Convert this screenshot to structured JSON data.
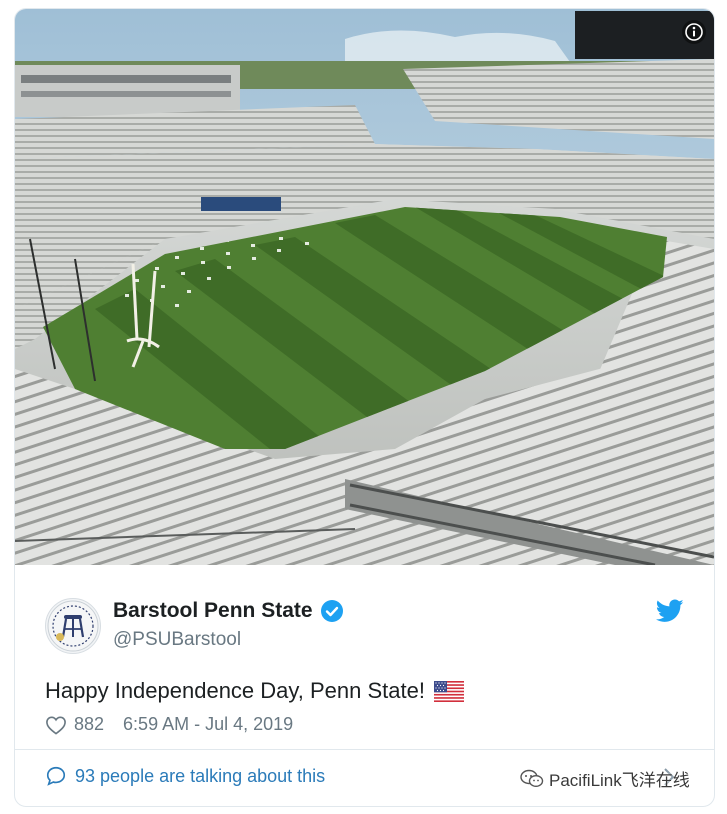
{
  "tweet": {
    "display_name": "Barstool Penn State",
    "handle": "@PSUBarstool",
    "text": "Happy Independence Day, Penn State!",
    "likes": "882",
    "timestamp": "6:59 AM - Jul 4, 2019",
    "conversation": "93 people are talking about this"
  },
  "icons": {
    "info": "info-icon",
    "verified": "verified-badge-icon",
    "twitter": "twitter-bird-icon",
    "flag": "us-flag-emoji",
    "like": "heart-outline-icon",
    "reply": "speech-bubble-icon",
    "wechat": "wechat-icon"
  },
  "colors": {
    "twitter_blue": "#1da1f2",
    "link_blue": "#2b7bb9",
    "muted": "#697882",
    "text": "#1c2022",
    "border": "#e1e8ed"
  },
  "watermark": {
    "text": "PacifiLink飞洋在线"
  }
}
